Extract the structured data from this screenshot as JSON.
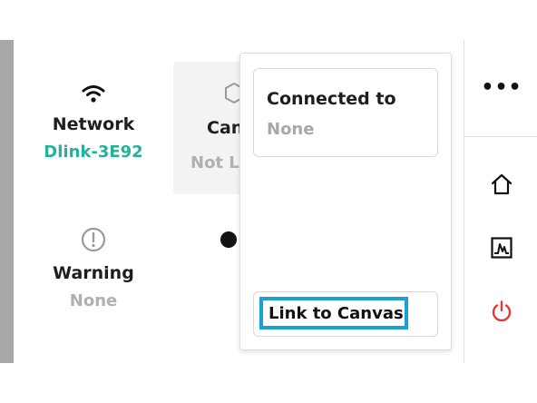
{
  "status": {
    "network": {
      "title": "Network",
      "value": "Dlink-3E92",
      "icon": "wifi-icon"
    },
    "warning": {
      "title": "Warning",
      "value": "None",
      "icon": "warning-circle-icon"
    },
    "canvas": {
      "title": "Can",
      "value": "Not Li",
      "icon": "hexagon-icon"
    }
  },
  "popup": {
    "connected_label": "Connected to",
    "connected_value": "None",
    "link_button": "Link to Canvas"
  },
  "rail": {
    "more_label": "•••",
    "icons": [
      "home-icon",
      "graph-icon",
      "power-icon"
    ]
  },
  "colors": {
    "accent_green": "#24b39a",
    "highlight_blue": "#1aa0d8",
    "power_red": "#e53935"
  }
}
